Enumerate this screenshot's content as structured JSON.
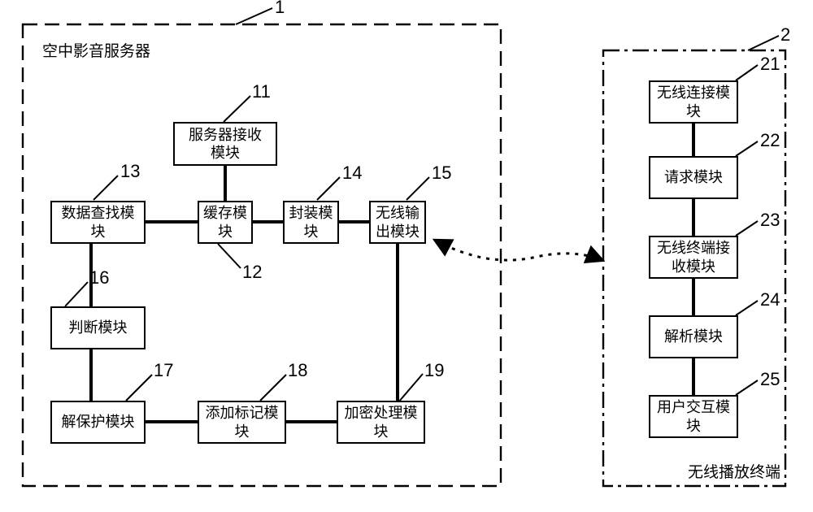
{
  "chart_data": {
    "type": "diagram",
    "title": "",
    "containers": [
      {
        "id": 1,
        "label": "空中影音服务器",
        "label_pos": "top-left"
      },
      {
        "id": 2,
        "label": "无线播放终端",
        "label_pos": "bottom-right"
      }
    ],
    "modules": {
      "server": [
        {
          "id": 11,
          "label": "服务器接收模块"
        },
        {
          "id": 12,
          "label": "缓存模块"
        },
        {
          "id": 13,
          "label": "数据查找模块"
        },
        {
          "id": 14,
          "label": "封装模块"
        },
        {
          "id": 15,
          "label": "无线输出模块"
        },
        {
          "id": 16,
          "label": "判断模块"
        },
        {
          "id": 17,
          "label": "解保护模块"
        },
        {
          "id": 18,
          "label": "添加标记模块"
        },
        {
          "id": 19,
          "label": "加密处理模块"
        }
      ],
      "terminal": [
        {
          "id": 21,
          "label": "无线连接模块"
        },
        {
          "id": 22,
          "label": "请求模块"
        },
        {
          "id": 23,
          "label": "无线终端接收模块"
        },
        {
          "id": 24,
          "label": "解析模块"
        },
        {
          "id": 25,
          "label": "用户交互模块"
        }
      ]
    },
    "connections": [
      [
        11,
        12
      ],
      [
        13,
        12
      ],
      [
        12,
        14
      ],
      [
        14,
        15
      ],
      [
        13,
        16
      ],
      [
        16,
        17
      ],
      [
        17,
        18
      ],
      [
        18,
        19
      ],
      [
        19,
        15
      ],
      [
        21,
        22
      ],
      [
        22,
        23
      ],
      [
        23,
        24
      ],
      [
        24,
        25
      ],
      {
        "from": 15,
        "to": 2,
        "type": "wireless_bidirectional"
      }
    ]
  },
  "c1_title": "空中影音服务器",
  "c2_title": "无线播放终端",
  "m11": "服务器接收\n模块",
  "m12": "缓存模\n块",
  "m13": "数据查找模\n块",
  "m14": "封装模\n块",
  "m15": "无线输\n出模块",
  "m16": "判断模块",
  "m17": "解保护模块",
  "m18": "添加标记模\n块",
  "m19": "加密处理模\n块",
  "m21": "无线连接模\n块",
  "m22": "请求模块",
  "m23": "无线终端接\n收模块",
  "m24": "解析模块",
  "m25": "用户交互模\n块",
  "n1": "1",
  "n2": "2",
  "n11": "11",
  "n12": "12",
  "n13": "13",
  "n14": "14",
  "n15": "15",
  "n16": "16",
  "n17": "17",
  "n18": "18",
  "n19": "19",
  "n21": "21",
  "n22": "22",
  "n23": "23",
  "n24": "24",
  "n25": "25"
}
